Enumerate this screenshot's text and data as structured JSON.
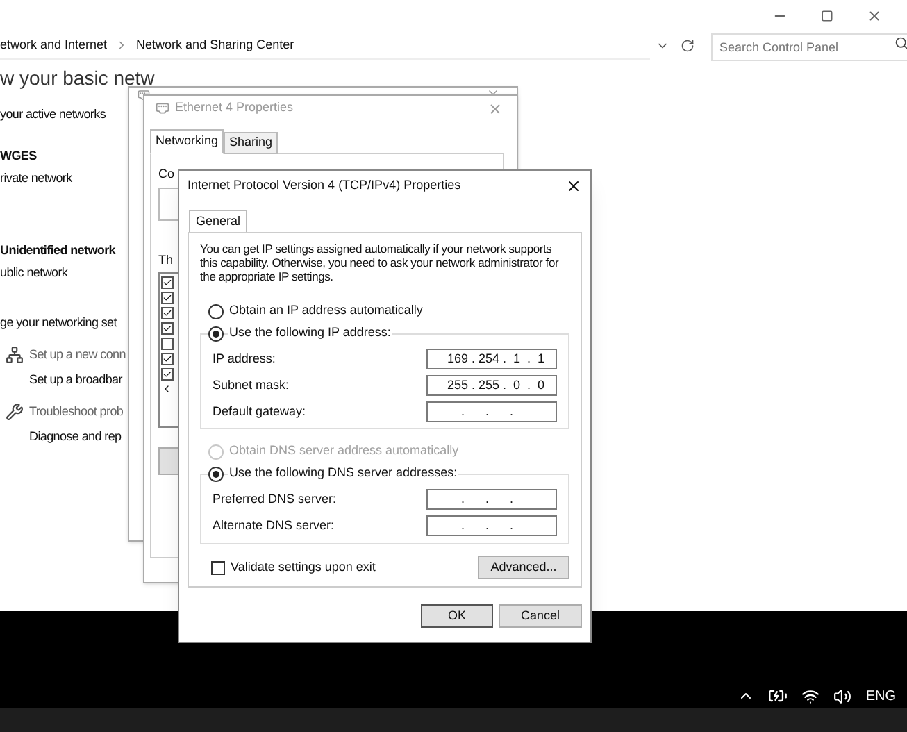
{
  "explorer": {
    "breadcrumb": [
      "etwork and Internet",
      "Network and Sharing Center"
    ],
    "search": {
      "placeholder": "Search Control Panel"
    }
  },
  "page": {
    "heading": "w your basic netw",
    "active_networks_label": "your active networks",
    "networks": [
      {
        "name": "WGES",
        "type": "rivate network"
      },
      {
        "name": "Unidentified network",
        "type": "ublic network"
      }
    ],
    "change_label": "ge your networking set",
    "tasks": [
      {
        "kind": "network",
        "title": "Set up a new conn",
        "description": "Set up a broadbar"
      },
      {
        "kind": "troubleshoot",
        "title": "Troubleshoot prob",
        "description": "Diagnose and rep"
      }
    ]
  },
  "properties": {
    "title": "Ethernet 4 Properties",
    "tabs": [
      {
        "label": "Networking",
        "selected": true
      },
      {
        "label": "Sharing",
        "selected": false
      }
    ],
    "connect_label": "Co",
    "items_label": "Th",
    "items": [
      {
        "checked": true
      },
      {
        "checked": true
      },
      {
        "checked": true
      },
      {
        "checked": true
      },
      {
        "checked": false
      },
      {
        "checked": true
      },
      {
        "checked": true
      }
    ]
  },
  "ipv4": {
    "title": "Internet Protocol Version 4 (TCP/IPv4) Properties",
    "tabs": [
      {
        "label": "General",
        "selected": true
      }
    ],
    "description": "You can get IP settings assigned automatically if your network supports this capability. Otherwise, you need to ask your network administrator for the appropriate IP settings.",
    "ip_auto": {
      "label": "Obtain an IP address automatically",
      "selected": false,
      "disabled": false
    },
    "ip_manual": {
      "label": "Use the following IP address:",
      "selected": true,
      "disabled": false
    },
    "ip_fields": [
      {
        "label": "IP address:",
        "value": "169 . 254 .  1  .  1"
      },
      {
        "label": "Subnet mask:",
        "value": "255 . 255 .  0  .  0"
      },
      {
        "label": "Default gateway:",
        "value": "    .      .      ."
      }
    ],
    "dns_auto": {
      "label": "Obtain DNS server address automatically",
      "selected": false,
      "disabled": true
    },
    "dns_manual": {
      "label": "Use the following DNS server addresses:",
      "selected": true,
      "disabled": false
    },
    "dns_fields": [
      {
        "label": "Preferred DNS server:",
        "value": "    .      .      ."
      },
      {
        "label": "Alternate DNS server:",
        "value": "    .      .      ."
      }
    ],
    "validate": {
      "label": "Validate settings upon exit",
      "checked": false
    },
    "advanced_button": "Advanced...",
    "ok_button": "OK",
    "cancel_button": "Cancel"
  },
  "taskbar": {
    "language": "ENG"
  }
}
